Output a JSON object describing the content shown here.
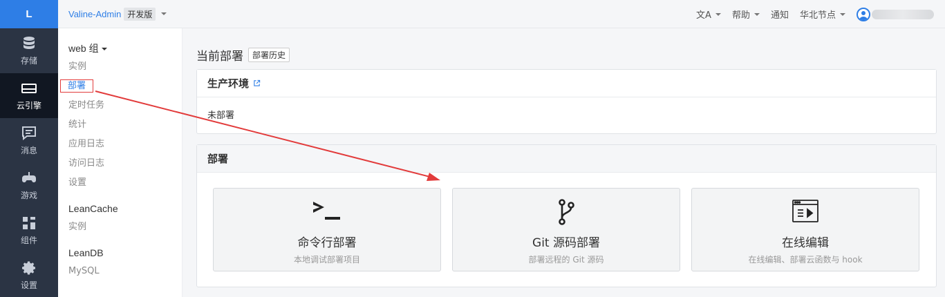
{
  "rail": {
    "logo": "L",
    "items": [
      {
        "label": "存储",
        "icon": "database-icon"
      },
      {
        "label": "云引擎",
        "icon": "server-icon",
        "active": true
      },
      {
        "label": "消息",
        "icon": "message-icon"
      },
      {
        "label": "游戏",
        "icon": "gamepad-icon"
      },
      {
        "label": "组件",
        "icon": "components-icon"
      },
      {
        "label": "设置",
        "icon": "gear-icon"
      }
    ]
  },
  "topbar": {
    "app_name": "Valine-Admin",
    "edition": "开发版",
    "links": {
      "translate": "文A",
      "help": "帮助",
      "notify": "通知",
      "region": "华北节点"
    }
  },
  "subnav": {
    "group1": "web 组",
    "group1_items": [
      "实例",
      "部署",
      "定时任务",
      "统计",
      "应用日志",
      "访问日志",
      "设置"
    ],
    "group2": "LeanCache",
    "group2_items": [
      "实例"
    ],
    "group3": "LeanDB",
    "group3_items": [
      "MySQL"
    ]
  },
  "main": {
    "title": "当前部署",
    "history_button": "部署历史",
    "prod_panel": {
      "title": "生产环境",
      "body": "未部署"
    },
    "deploy_panel": {
      "title": "部署",
      "cards": [
        {
          "title": "命令行部署",
          "desc": "本地调试部署项目",
          "icon": "terminal-icon"
        },
        {
          "title": "Git 源码部署",
          "desc": "部署远程的 Git 源码",
          "icon": "git-branch-icon"
        },
        {
          "title": "在线编辑",
          "desc": "在线编辑、部署云函数与 hook",
          "icon": "editor-icon"
        }
      ]
    }
  },
  "colors": {
    "accent": "#2e7ee6",
    "rail_bg": "#2b3444",
    "annotation_red": "#e23b3b"
  }
}
